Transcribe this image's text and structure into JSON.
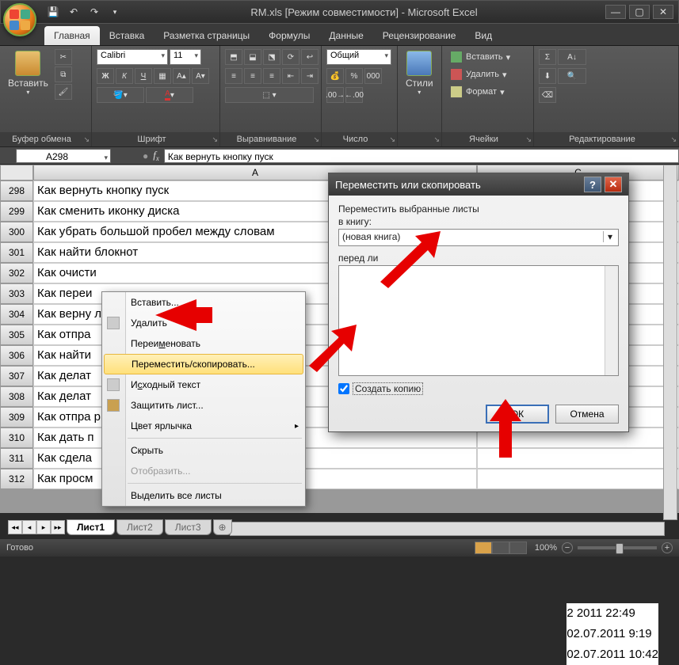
{
  "titlebar": {
    "title": "RM.xls  [Режим совместимости] - Microsoft Excel"
  },
  "tabs": [
    "Главная",
    "Вставка",
    "Разметка страницы",
    "Формулы",
    "Данные",
    "Рецензирование",
    "Вид"
  ],
  "ribbon": {
    "group_clipboard": "Буфер обмена",
    "paste": "Вставить",
    "group_font": "Шрифт",
    "font_name": "Calibri",
    "font_size": "11",
    "group_align": "Выравнивание",
    "group_number": "Число",
    "number_format": "Общий",
    "group_styles": "Стили",
    "styles": "Стили",
    "group_cells": "Ячейки",
    "insert": "Вставить",
    "delete": "Удалить",
    "format": "Формат",
    "group_edit": "Редактирование"
  },
  "formula": {
    "name_box": "A298",
    "value": "Как вернуть кнопку пуск"
  },
  "columns": [
    "A",
    "C"
  ],
  "rows": [
    {
      "n": "298",
      "a": "Как вернуть кнопку пуск"
    },
    {
      "n": "299",
      "a": "Как сменить иконку диска"
    },
    {
      "n": "300",
      "a": "Как убрать большой пробел между словам"
    },
    {
      "n": "301",
      "a": "Как найти блокнот"
    },
    {
      "n": "302",
      "a": "Как очисти"
    },
    {
      "n": "303",
      "a": "Как переи"
    },
    {
      "n": "304",
      "a": "Как верну                                         лчан"
    },
    {
      "n": "305",
      "a": "Как отпра"
    },
    {
      "n": "306",
      "a": "Как найти"
    },
    {
      "n": "307",
      "a": "Как делат"
    },
    {
      "n": "308",
      "a": "Как делат"
    },
    {
      "n": "309",
      "a": "Как отпра                                 рн"
    },
    {
      "n": "310",
      "a": "Как дать п"
    },
    {
      "n": "311",
      "a": "Как сдела"
    },
    {
      "n": "312",
      "a": "Как просм"
    }
  ],
  "context_menu": {
    "insert": "Вставить...",
    "delete": "Удалить",
    "rename": "Переименовать",
    "move_copy": "Переместить/скопировать...",
    "source": "Исходный текст",
    "protect": "Защитить лист...",
    "tab_color": "Цвет ярлычка",
    "hide": "Скрыть",
    "unhide": "Отобразить...",
    "select_all": "Выделить все листы"
  },
  "dialog": {
    "title": "Переместить или скопировать",
    "label1": "Переместить выбранные листы",
    "label2": "в книгу:",
    "book": "(новая книга)",
    "label3": "перед ли",
    "create_copy": "Создать копию",
    "ok": "ОК",
    "cancel": "Отмена"
  },
  "timestamps": [
    "2 2011 22:49",
    "02.07.2011 9:19",
    "02.07.2011 10:42"
  ],
  "sheets": {
    "nav": [
      "◂◂",
      "◂",
      "▸",
      "▸▸"
    ],
    "tabs": [
      "Лист1",
      "Лист2",
      "Лист3"
    ]
  },
  "status": {
    "ready": "Готово",
    "zoom": "100%"
  }
}
